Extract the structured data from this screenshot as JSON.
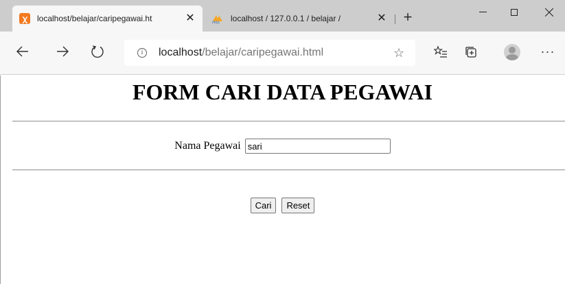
{
  "tabs": [
    {
      "title": "localhost/belajar/caripegawai.ht",
      "icon": "xampp-icon",
      "active": true
    },
    {
      "title": "localhost / 127.0.0.1 / belajar / ",
      "icon": "phpmyadmin-icon",
      "active": false
    }
  ],
  "toolbar": {
    "url_host": "localhost",
    "url_path": "/belajar/caripegawai.html"
  },
  "page": {
    "title": "FORM CARI DATA PEGAWAI",
    "name_label": "Nama Pegawai",
    "name_value": "sari",
    "search_button": "Cari",
    "reset_button": "Reset"
  }
}
